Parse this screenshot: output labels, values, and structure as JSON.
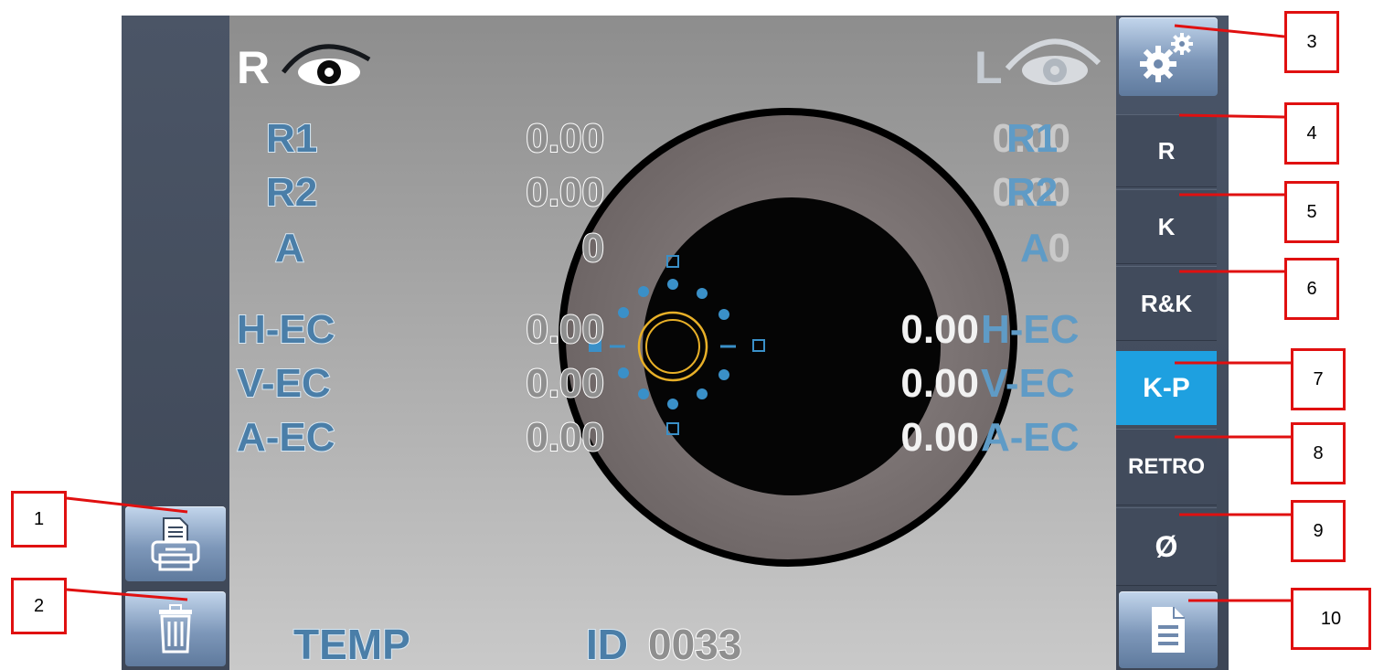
{
  "screen": {
    "right_eye_letter": "R",
    "left_eye_letter": "L",
    "right_readings": [
      {
        "label": "R1",
        "value": "0.00"
      },
      {
        "label": "R2",
        "value": "0.00"
      },
      {
        "label": "A",
        "value": "0"
      },
      {
        "label": "H-EC",
        "value": "0.00"
      },
      {
        "label": "V-EC",
        "value": "0.00"
      },
      {
        "label": "A-EC",
        "value": "0.00"
      }
    ],
    "left_readings": [
      {
        "label": "R1",
        "value": "0.00"
      },
      {
        "label": "R2",
        "value": "0.00"
      },
      {
        "label": "A",
        "value": "0"
      },
      {
        "label": "H-EC",
        "value": "0.00"
      },
      {
        "label": "V-EC",
        "value": "0.00"
      },
      {
        "label": "A-EC",
        "value": "0.00"
      }
    ],
    "mode_label": "TEMP",
    "id_prefix": "ID",
    "id_number": "0033"
  },
  "left_toolbar": {
    "print_icon": "printer-icon",
    "delete_icon": "trash-icon"
  },
  "right_toolbar": {
    "settings_icon": "gears-icon",
    "buttons": [
      "R",
      "K",
      "R&K",
      "K-P",
      "RETRO",
      "Ø"
    ],
    "active_button": "K-P",
    "report_icon": "document-icon"
  },
  "callouts": [
    "1",
    "2",
    "3",
    "4",
    "5",
    "6",
    "7",
    "8",
    "9",
    "10"
  ],
  "colors": {
    "label_blue": "#4a7ea8",
    "active_mode": "#1ea0e0",
    "callout_red": "#e01010",
    "target_ring": "#e8b028"
  }
}
